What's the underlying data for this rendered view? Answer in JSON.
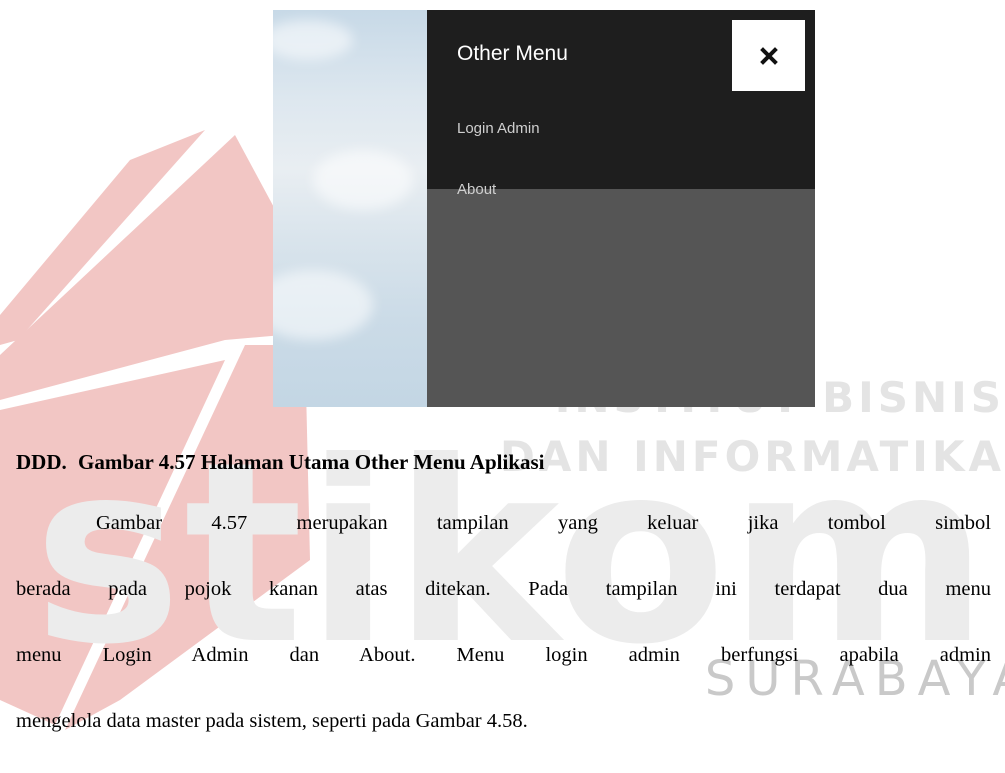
{
  "screenshot": {
    "menu_title": "Other Menu",
    "menu_items": [
      {
        "label": "Login Admin"
      },
      {
        "label": "About"
      }
    ],
    "close_icon": "close-x-icon",
    "colors": {
      "panel_dark": "#1e1e1e",
      "panel_gray": "#555555",
      "close_bg": "#ffffff"
    }
  },
  "caption": {
    "marker": "DDD.",
    "text": "Gambar 4.57 Halaman Utama Other Menu Aplikasi"
  },
  "paragraph": {
    "lines": [
      "Gambar 4.57 merupakan tampilan yang keluar jika tombol simbol",
      "berada pada pojok kanan atas ditekan. Pada tampilan ini terdapat dua menu",
      "menu Login Admin dan About. Menu login admin berfungsi apabila admin",
      "mengelola data master pada sistem, seperti pada Gambar 4.58."
    ]
  },
  "watermark": {
    "brand": "stikom",
    "city": "SURABAYA",
    "line1": "INSTITUT BISNIS",
    "line2": "DAN INFORMATIKA",
    "colors": {
      "logo_red": "#f2c6c4",
      "text_gray": "#e4e4e4",
      "brand_gray": "#ececec"
    }
  }
}
